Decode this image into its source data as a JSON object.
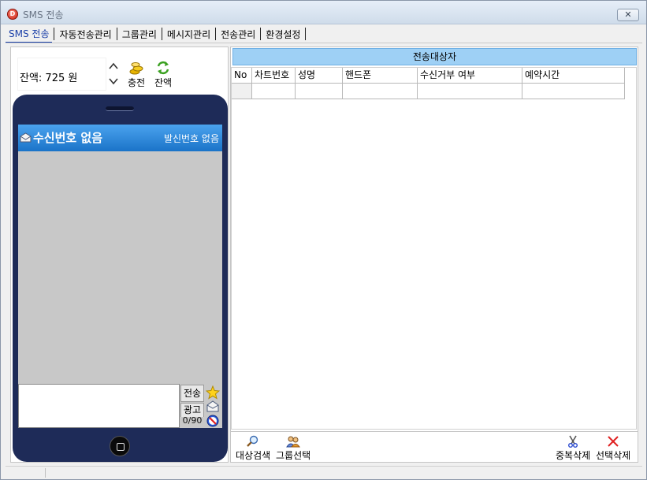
{
  "window": {
    "title": "SMS 전송",
    "close_label": "✕"
  },
  "tabs": [
    {
      "label": "SMS 전송",
      "active": true
    },
    {
      "label": "자동전송관리",
      "active": false
    },
    {
      "label": "그룹관리",
      "active": false
    },
    {
      "label": "메시지관리",
      "active": false
    },
    {
      "label": "전송관리",
      "active": false
    },
    {
      "label": "환경설정",
      "active": false
    }
  ],
  "balance": {
    "text": "잔액: 725 원",
    "charge_label": "충전",
    "refresh_label": "잔액"
  },
  "phone": {
    "receiver": "수신번호 없음",
    "sender": "발신번호 없음",
    "message": "",
    "send_label": "전송",
    "ad_label": "광고",
    "counter": "0/90"
  },
  "targets": {
    "title": "전송대상자",
    "columns": [
      "No",
      "차트번호",
      "성명",
      "핸드폰",
      "수신거부 여부",
      "예약시간"
    ],
    "rows": [
      [
        "",
        "",
        "",
        "",
        "",
        ""
      ]
    ]
  },
  "tools": {
    "search_label": "대상검색",
    "group_select_label": "그룹선택",
    "dedupe_label": "중복삭제",
    "delete_selected_label": "선택삭제"
  },
  "colors": {
    "phone_body": "#1e2b58",
    "screen_header": "#1a73c8",
    "targets_header": "#9ed0f5",
    "active_tab": "#1a3fa8",
    "delete_icon": "#e02020"
  }
}
